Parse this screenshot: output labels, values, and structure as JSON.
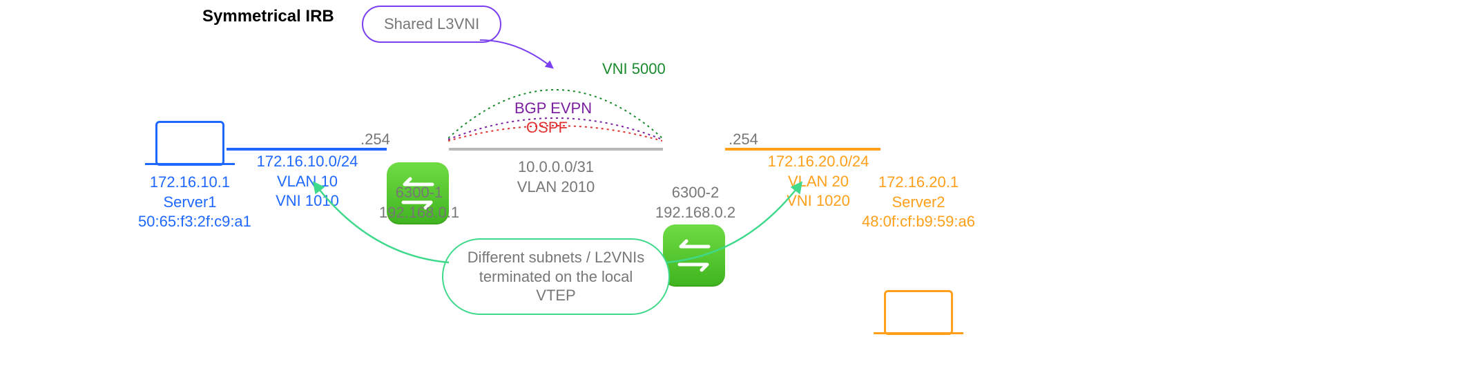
{
  "title": "Symmetrical IRB",
  "l3vni_bubble": "Shared L3VNI",
  "vni5000": "VNI 5000",
  "bgp": "BGP EVPN",
  "ospf": "OSPF",
  "core": {
    "subnet": "10.0.0.0/31",
    "vlan": "VLAN 2010"
  },
  "server1": {
    "ip": "172.16.10.1",
    "name": "Server1",
    "mac": "50:65:f3:2f:c9:a1"
  },
  "left_net": {
    "subnet": "172.16.10.0/24",
    "vlan": "VLAN 10",
    "vni": "VNI 1010",
    "gw": ".254"
  },
  "switch1": {
    "name": "6300-1",
    "lo": "192.168.0.1"
  },
  "switch2": {
    "name": "6300-2",
    "lo": "192.168.0.2"
  },
  "right_net": {
    "subnet": "172.16.20.0/24",
    "vlan": "VLAN 20",
    "vni": "VNI 1020",
    "gw": ".254"
  },
  "server2": {
    "ip": "172.16.20.1",
    "name": "Server2",
    "mac": "48:0f:cf:b9:59:a6"
  },
  "l2vni_bubble_l1": "Different subnets / L2VNIs",
  "l2vni_bubble_l2": "terminated on the local VTEP"
}
